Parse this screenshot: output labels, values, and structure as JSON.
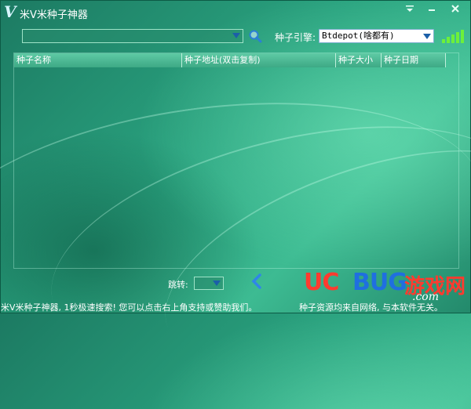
{
  "window": {
    "logo": "V",
    "title": "米V米种子神器",
    "menu_icon": "menu-icon",
    "minimize_icon": "minimize-icon",
    "close_icon": "close-icon"
  },
  "toolbar": {
    "search_value": "",
    "search_icon": "search-icon",
    "engine_label": "种子引擎:",
    "engine_selected": "Btdepot(啥都有)",
    "signal_icon": "signal-bars-icon"
  },
  "list": {
    "columns": [
      "种子名称",
      "种子地址(双击复制)",
      "种子大小",
      "种子日期"
    ],
    "rows": []
  },
  "pager": {
    "jump_label": "跳转:",
    "jump_value": "",
    "prev_icon": "chevron-left-icon"
  },
  "status": {
    "left": "米V米种子神器, 1秒极速搜索! 您可以点击右上角支持或赞助我们。",
    "right": "种子资源均来自网络, 与本软件无关。"
  },
  "watermark": {
    "uc": "UC",
    "bug": "BUG",
    "cn": "游戏网",
    "com": ".com"
  },
  "colors": {
    "background": "#2aa37f",
    "header": "#4fbb96",
    "signal": "#6df03a",
    "accent_blue": "#2f86e8"
  }
}
